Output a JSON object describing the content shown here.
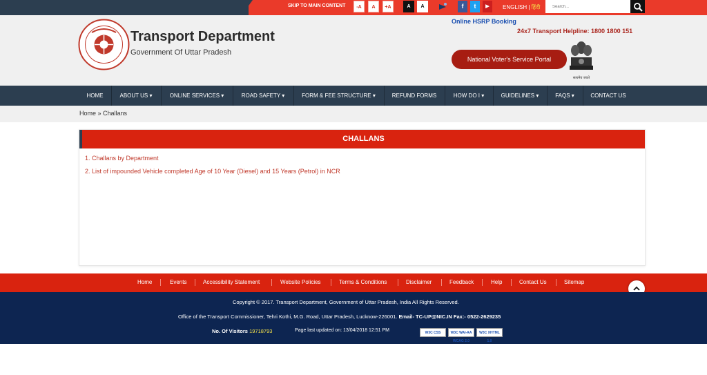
{
  "topbar": {
    "skip": "SKIP TO MAIN CONTENT",
    "font_controls": [
      "-A",
      "A",
      "+A"
    ],
    "contrast_controls": [
      "A",
      "A"
    ],
    "lang_en": "ENGLISH",
    "lang_sep": " | ",
    "lang_hi": "हिंदी",
    "search_placeholder": "Search...",
    "social": [
      "f",
      "t",
      "▶"
    ]
  },
  "header": {
    "title": "Transport Department",
    "subtitle": "Government Of Uttar Pradesh",
    "hsrp": "Online HSRP Booking",
    "helpline": "24x7 Transport Helpline: 1800 1800 151",
    "voter_button": "National Voter's Service Portal",
    "logo_motto": "परिवहन विभाग",
    "emblem_caption": "सत्यमेव जयते"
  },
  "nav": [
    {
      "label": "HOME",
      "dropdown": false
    },
    {
      "label": "ABOUT US",
      "dropdown": true
    },
    {
      "label": "ONLINE SERVICES",
      "dropdown": true
    },
    {
      "label": "ROAD SAFETY",
      "dropdown": true
    },
    {
      "label": "FORM & FEE STRUCTURE",
      "dropdown": true
    },
    {
      "label": "REFUND FORMS",
      "dropdown": false
    },
    {
      "label": "HOW DO I",
      "dropdown": true
    },
    {
      "label": "GUIDELINES",
      "dropdown": true
    },
    {
      "label": "FAQS",
      "dropdown": true
    },
    {
      "label": "CONTACT US",
      "dropdown": false
    }
  ],
  "breadcrumb": "Home » Challans",
  "panel": {
    "title": "CHALLANS",
    "links": [
      "1. Challans by Department",
      "2. List of impounded Vehicle completed Age of 10 Year (Diesel) and 15 Years (Petrol) in NCR"
    ]
  },
  "footer_links": [
    "Home",
    "Events",
    "Accessibility Statement",
    "Website Policies",
    "Terms & Conditions",
    "Disclaimer",
    "Feedback",
    "Help",
    "Contact Us",
    "Sitemap"
  ],
  "footer": {
    "copyright": "Copyright © 2017. Transport Department, Government of Uttar Pradesh, India All Rights Reserved.",
    "address": "Office of the Transport Commissioner, Tehri Kothi, M.G. Road, Uttar Pradesh, Lucknow-226001.",
    "email_label": "Email- TC-UP@NIC.IN",
    "fax_label": "Fax:- 0522-2629235",
    "visitors_label": "No. Of Visitors",
    "visitors_count": "19718793",
    "updated": "Page last updated on: 13/04/2018 12:51 PM",
    "badges": [
      "W3C CSS",
      "W3C WAI-AA WCAG 2.0",
      "W3C XHTML 1.0"
    ]
  },
  "colors": {
    "nav": "#2c3e50",
    "accent": "#d9230f",
    "footer": "#0d2551"
  }
}
